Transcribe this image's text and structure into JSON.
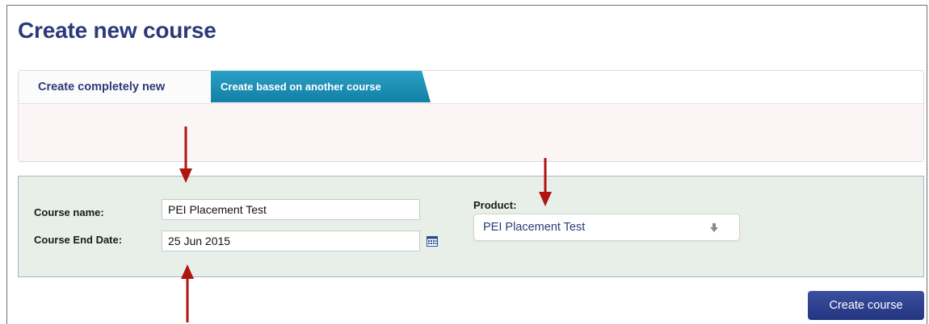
{
  "page": {
    "title": "Create new course"
  },
  "tabs": [
    {
      "label": "Create completely new",
      "active": true
    },
    {
      "label": "Create based on another course",
      "active": false
    }
  ],
  "form": {
    "course_name": {
      "label": "Course name:",
      "value": "PEI Placement Test"
    },
    "course_end_date": {
      "label": "Course End Date:",
      "value": "25 Jun 2015",
      "icon": "calendar-icon"
    },
    "product": {
      "label": "Product:",
      "selected": "PEI Placement Test",
      "icon": "dropdown-arrow-icon"
    }
  },
  "actions": {
    "create_label": "Create course"
  },
  "annotations": {
    "arrow_color": "#b0140f",
    "count": 3
  },
  "colors": {
    "title": "#2c3a7a",
    "tab_active_bg": "#fbfbfb",
    "tab_inactive_bg": "#1a8fb6",
    "form_panel_bg": "#e8efe8",
    "button_bg": "#2e4191"
  }
}
